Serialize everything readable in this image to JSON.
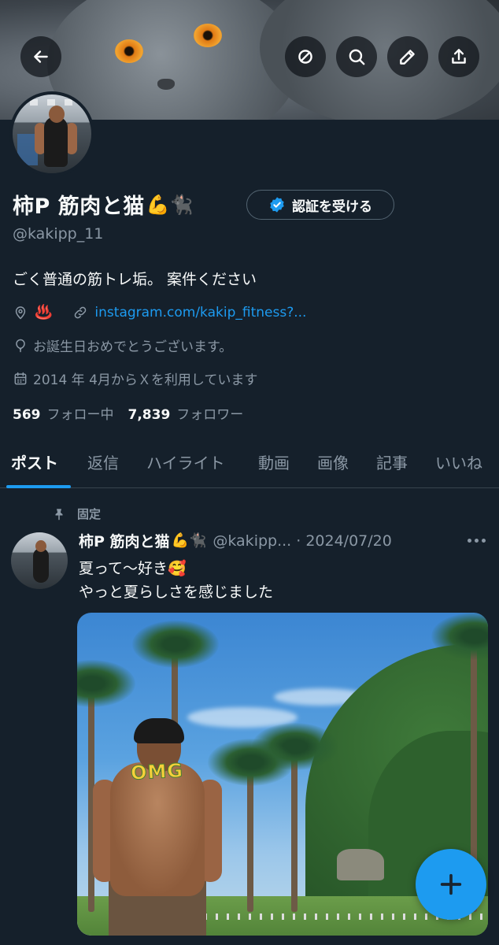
{
  "header": {
    "back_icon": "arrow-left-icon",
    "actions": [
      "circle-slash-icon",
      "search-icon",
      "pen-icon",
      "share-icon"
    ]
  },
  "profile": {
    "name": "柿P 筋肉と猫",
    "name_emoji": "💪🐈‍⬛",
    "verify_button": "認証を受ける",
    "handle": "@kakipp_11",
    "bio": "ごく普通の筋トレ垢。 案件ください",
    "location_emoji": "♨️",
    "link": "instagram.com/kakip_fitness?...",
    "birthday": "お誕生日おめでとうございます。",
    "joined": "2014 年 4月からＸを利用しています",
    "following_count": "569",
    "following_label": "フォロー中",
    "followers_count": "7,839",
    "followers_label": "フォロワー"
  },
  "tabs": [
    "ポスト",
    "返信",
    "ハイライト",
    "動画",
    "画像",
    "記事",
    "いいね"
  ],
  "active_tab": "ポスト",
  "pinned_post": {
    "pinned_label": "固定",
    "author_name": "柿P 筋肉と猫",
    "author_emoji": "💪🐈‍⬛",
    "author_handle": "@kakipp... · 2024/07/20",
    "text_line1": "夏って〜好き🥰",
    "text_line2": "やっと夏らしさを感じました",
    "image_sticker": "OMG"
  },
  "colors": {
    "background": "#15202b",
    "accent": "#1d9bf0",
    "text_primary": "#f7f9f9",
    "text_secondary": "#8b98a5",
    "border": "#38444d"
  }
}
